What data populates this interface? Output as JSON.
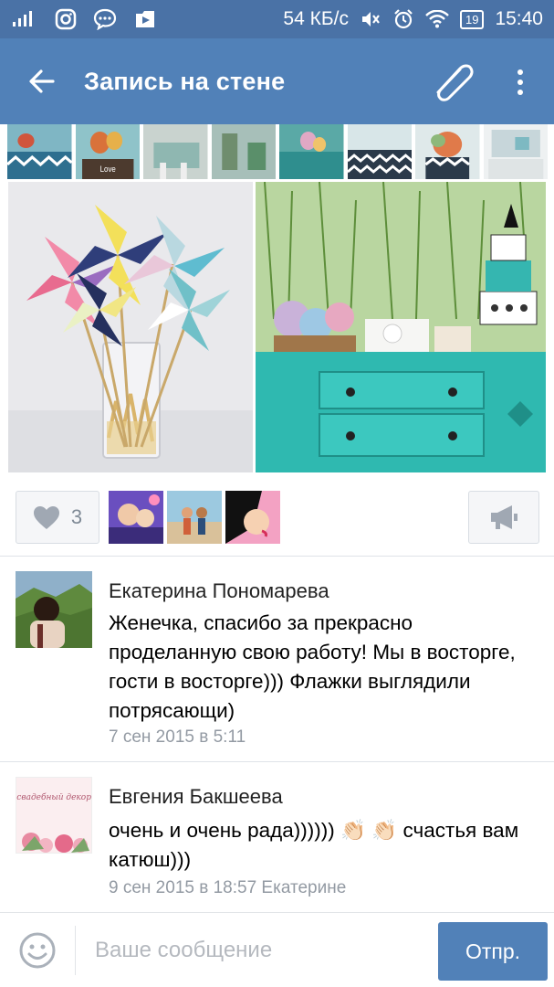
{
  "status_bar": {
    "icons_left": [
      "signal-icon",
      "instagram-icon",
      "chat-icon",
      "youtube-icon"
    ],
    "speed": "54 КБ/с",
    "icons_right": [
      "mute-icon",
      "alarm-icon",
      "wifi-icon"
    ],
    "battery": "19",
    "time": "15:40"
  },
  "app_bar": {
    "title": "Запись на стене",
    "icons": [
      "back-arrow-icon",
      "paperclip-icon",
      "more-vertical-icon"
    ]
  },
  "post": {
    "likes_count": "3",
    "like_icon": "heart-icon",
    "share_icon": "megaphone-icon"
  },
  "comments": [
    {
      "author": "Екатерина Пономарева",
      "text": "Женечка, спасибо за прекрасно проделанную свою работу! Мы в восторге, гости в восторге))) Флажки выглядили потрясающи)",
      "meta": "7 сен 2015 в 5:11"
    },
    {
      "author": "Евгения Бакшеева",
      "text": "очень и очень рада)))))) 👏🏻 👏🏻 счастья вам катюш)))",
      "meta": "9 сен 2015 в 18:57 Екатерине",
      "avatar_text": "Ваш свадебный декоратор"
    }
  ],
  "composer": {
    "placeholder": "Ваше сообщение",
    "send_label": "Отпр.",
    "emoji_icon": "smiley-icon"
  },
  "colors": {
    "status_bar": "#4a72a6",
    "app_bar": "#5181b8",
    "accent": "#5181b8",
    "meta_text": "#939aa3"
  }
}
